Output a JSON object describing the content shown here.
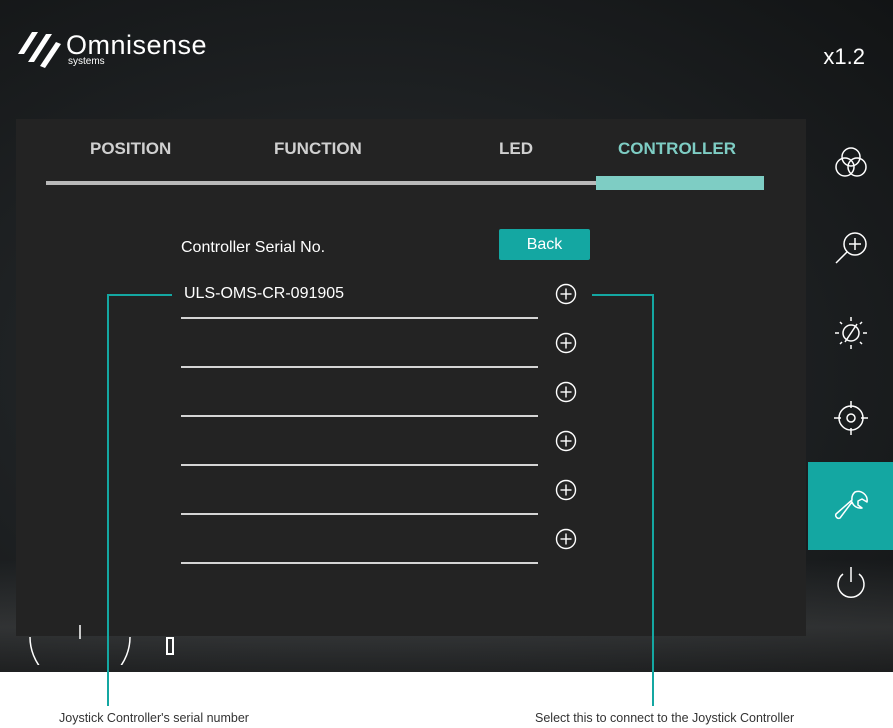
{
  "app": {
    "brand_name": "Omnisense",
    "brand_sub": "systems",
    "zoom_level": "x1.2"
  },
  "tabs": [
    {
      "label": "POSITION",
      "active": false
    },
    {
      "label": "FUNCTION",
      "active": false
    },
    {
      "label": "LED",
      "active": false
    },
    {
      "label": "CONTROLLER",
      "active": true
    }
  ],
  "controller": {
    "serial_label": "Controller Serial No.",
    "back_label": "Back",
    "rows": [
      {
        "value": "ULS-OMS-CR-091905"
      },
      {
        "value": ""
      },
      {
        "value": ""
      },
      {
        "value": ""
      },
      {
        "value": ""
      },
      {
        "value": ""
      }
    ]
  },
  "sidebar": {
    "items": [
      {
        "icon": "color-circles-icon",
        "active": false
      },
      {
        "icon": "zoom-in-icon",
        "active": false
      },
      {
        "icon": "brightness-icon",
        "active": false
      },
      {
        "icon": "target-icon",
        "active": false
      },
      {
        "icon": "wrench-icon",
        "active": true
      },
      {
        "icon": "power-icon",
        "active": false
      }
    ]
  },
  "annotations": {
    "left_caption": "Joystick Controller's serial number",
    "right_caption": "Select this to connect to the Joystick Controller"
  },
  "colors": {
    "accent": "#14a7a2",
    "tab_active": "#7ecdc4",
    "panel": "#232323",
    "tab_track": "#b9b9b9"
  }
}
